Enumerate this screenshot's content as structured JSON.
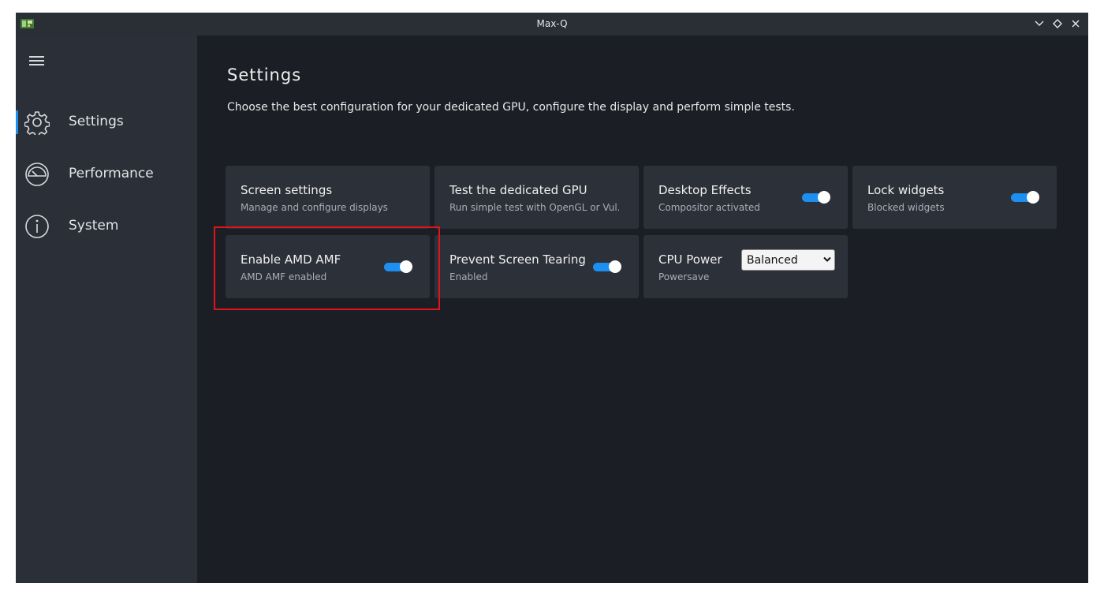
{
  "window": {
    "title": "Max-Q",
    "controls": [
      "minimize",
      "maximize",
      "close"
    ]
  },
  "sidebar": {
    "menu_icon": "hamburger-menu-icon",
    "items": [
      {
        "label": "Settings",
        "icon": "gear-icon",
        "active": true
      },
      {
        "label": "Performance",
        "icon": "gauge-icon",
        "active": false
      },
      {
        "label": "System",
        "icon": "info-icon",
        "active": false
      }
    ],
    "accent_color": "#1d8ff0"
  },
  "main": {
    "title": "Settings",
    "description": "Choose the best configuration for your dedicated GPU, configure the display and perform simple tests.",
    "cards": [
      {
        "title": "Screen settings",
        "subtitle": "Manage and configure displays"
      },
      {
        "title": "Test the dedicated GPU",
        "subtitle": "Run simple test with OpenGL or Vul..."
      },
      {
        "title": "Desktop Effects",
        "subtitle": "Compositor activated",
        "toggle": true
      },
      {
        "title": "Lock widgets",
        "subtitle": "Blocked widgets",
        "toggle": true
      },
      {
        "title": "Enable AMD AMF",
        "subtitle": "AMD AMF enabled",
        "toggle": true,
        "highlighted": true
      },
      {
        "title": "Prevent Screen Tearing",
        "subtitle": "Enabled",
        "toggle": true
      },
      {
        "title": "CPU Power",
        "subtitle": "Powersave",
        "select_value": "Balanced"
      }
    ]
  },
  "colors": {
    "background": "#1b1e24",
    "sidebar": "#2b2f37",
    "card": "#2c3038",
    "toggle_on": "#1d8ff0",
    "highlight": "#e0141a"
  }
}
